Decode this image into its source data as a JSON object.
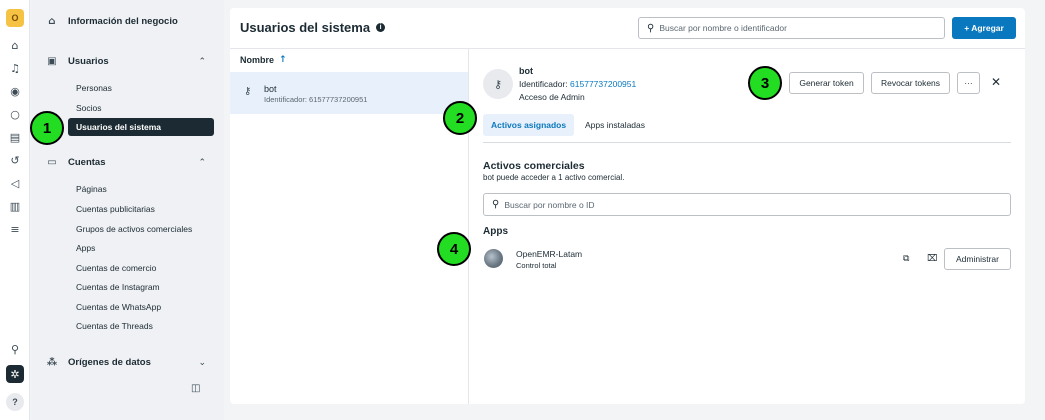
{
  "rail": {
    "avatar_letter": "O",
    "help_label": "?"
  },
  "sidebar": {
    "business_info": "Información del negocio",
    "users_section": "Usuarios",
    "users_items": [
      "Personas",
      "Socios",
      "Usuarios del sistema"
    ],
    "accounts_section": "Cuentas",
    "accounts_items": [
      "Páginas",
      "Cuentas publicitarias",
      "Grupos de activos comerciales",
      "Apps",
      "Cuentas de comercio",
      "Cuentas de Instagram",
      "Cuentas de WhatsApp",
      "Cuentas de Threads"
    ],
    "data_sources": "Orígenes de datos"
  },
  "header": {
    "title": "Usuarios del sistema",
    "search_placeholder": "Buscar por nombre o identificador",
    "add_button": "+ Agregar"
  },
  "list": {
    "column_header": "Nombre",
    "rows": [
      {
        "name": "bot",
        "id_text": "Identificador: 61577737200951"
      }
    ]
  },
  "details": {
    "name": "bot",
    "id_label": "Identificador:",
    "id_value": "61577737200951",
    "role": "Acceso de Admin",
    "generate_token": "Generar token",
    "revoke_tokens": "Revocar tokens",
    "more": "···",
    "tabs": [
      "Activos asignados",
      "Apps instaladas"
    ],
    "assets_title": "Activos comerciales",
    "assets_subtitle": "bot puede acceder a 1 activo comercial.",
    "assets_search_placeholder": "Buscar por nombre o ID",
    "apps_title": "Apps",
    "app": {
      "name": "OpenEMR-Latam",
      "permission": "Control total",
      "manage_button": "Administrar"
    }
  },
  "annotations": [
    "1",
    "2",
    "3",
    "4"
  ],
  "colors": {
    "accent": "#0a78be",
    "selected_nav": "#1c2b33",
    "annotation_fill": "#22dd22"
  }
}
